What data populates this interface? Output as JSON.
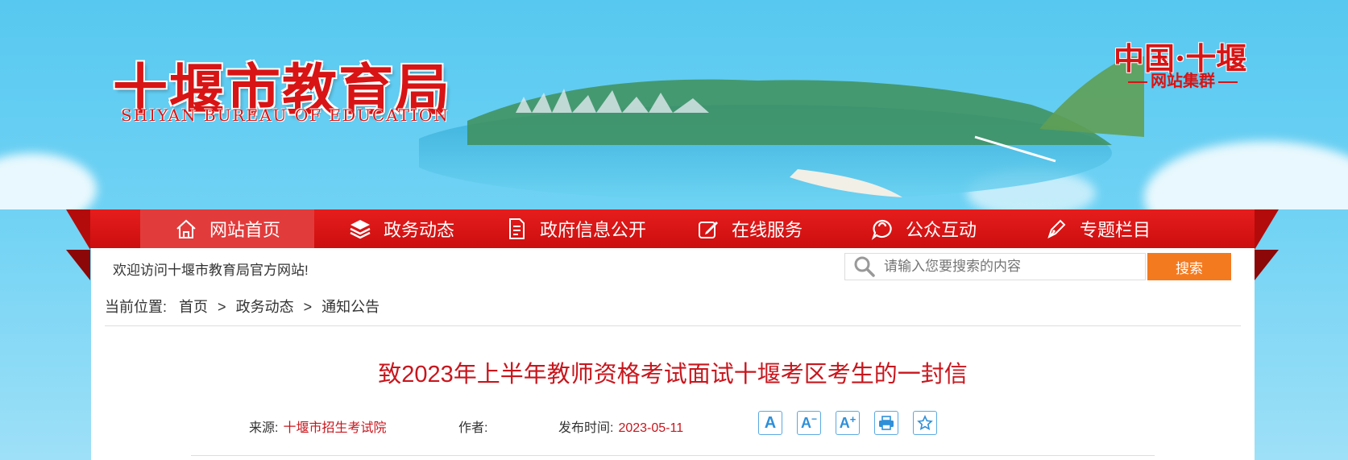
{
  "header": {
    "site_name": "十堰市教育局",
    "site_name_en": "SHIYAN BUREAU OF EDUCATION",
    "cluster_title": "中国·十堰",
    "cluster_subtitle": "网站集群"
  },
  "nav": {
    "items": [
      {
        "label": "网站首页",
        "icon": "home-icon",
        "active": true
      },
      {
        "label": "政务动态",
        "icon": "layers-icon",
        "active": false
      },
      {
        "label": "政府信息公开",
        "icon": "document-icon",
        "active": false
      },
      {
        "label": "在线服务",
        "icon": "edit-icon",
        "active": false
      },
      {
        "label": "公众互动",
        "icon": "chat-icon",
        "active": false
      },
      {
        "label": "专题栏目",
        "icon": "pen-icon",
        "active": false
      }
    ]
  },
  "topbar": {
    "welcome": "欢迎访问十堰市教育局官方网站!",
    "search_placeholder": "请输入您要搜索的内容",
    "search_button": "搜索"
  },
  "breadcrumb": {
    "label": "当前位置:",
    "items": [
      "首页",
      "政务动态",
      "通知公告"
    ],
    "separator": ">"
  },
  "article": {
    "title": "致2023年上半年教师资格考试面试十堰考区考生的一封信",
    "source_label": "来源:",
    "source": "十堰市招生考试院",
    "author_label": "作者:",
    "author": "",
    "date_label": "发布时间:",
    "date": "2023-05-11",
    "tools": [
      "font-large-icon",
      "font-decrease-icon",
      "font-increase-icon",
      "print-icon",
      "favorite-icon"
    ]
  },
  "colors": {
    "brand_red": "#d81414",
    "nav_red": "#cc0e0e",
    "search_orange": "#f47a20",
    "title_red": "#c8161d",
    "tool_blue": "#2f8fd8"
  }
}
